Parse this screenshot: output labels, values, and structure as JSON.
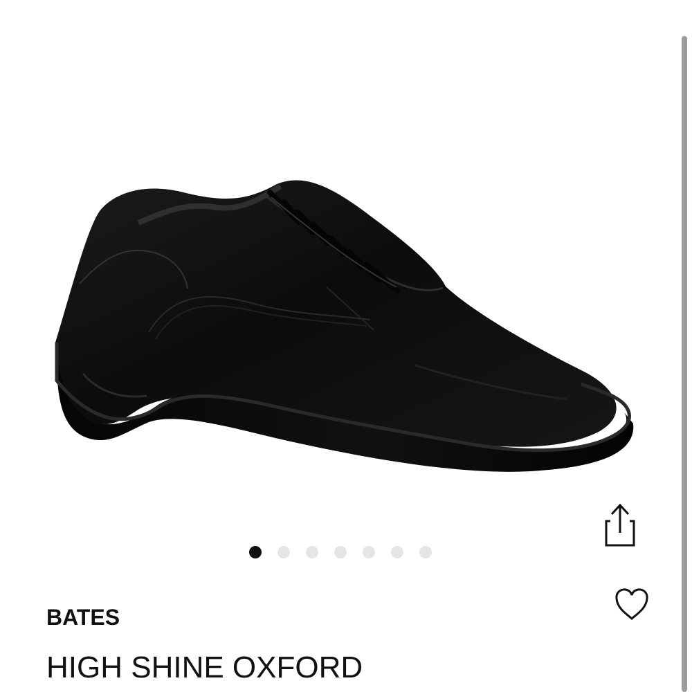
{
  "product": {
    "brand": "BATES",
    "title": "HIGH SHINE OXFORD"
  },
  "carousel": {
    "total_images": 7,
    "active_index": 0
  },
  "actions": {
    "share_icon": "share-icon",
    "favorite_icon": "heart-icon"
  },
  "colors": {
    "text": "#111111",
    "active_dot": "#111111",
    "inactive_dot": "#e5e5e5",
    "scrollbar": "#9b9b9b"
  }
}
